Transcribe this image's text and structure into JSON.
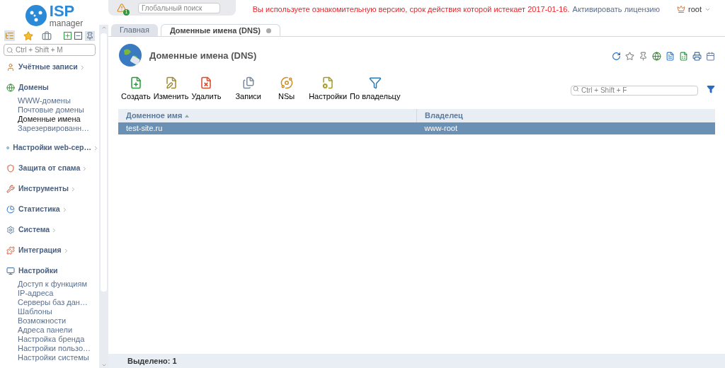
{
  "logo": {
    "big": "ISP",
    "small": "manager"
  },
  "global_search": {
    "placeholder": "Глобальный поиск"
  },
  "notice": {
    "text": "Вы используете ознакомительную версию, срок действия которой истекает 2017-01-16.",
    "link": "Активировать лицензию"
  },
  "user": {
    "name": "root"
  },
  "alert_badge": "1",
  "sidebar": {
    "search": {
      "placeholder": "Ctrl + Shift + M"
    },
    "groups": [
      {
        "title": "Учётные записи"
      },
      {
        "title": "Домены",
        "children": [
          {
            "label": "WWW-домены",
            "selected": false
          },
          {
            "label": "Почтовые домены",
            "selected": false
          },
          {
            "label": "Доменные имена",
            "selected": true
          },
          {
            "label": "Зарезервированн…",
            "selected": false
          }
        ]
      },
      {
        "title": "Настройки web-сер…"
      },
      {
        "title": "Защита от спама"
      },
      {
        "title": "Инструменты"
      },
      {
        "title": "Статистика"
      },
      {
        "title": "Система"
      },
      {
        "title": "Интеграция"
      },
      {
        "title": "Настройки",
        "children": [
          {
            "label": "Доступ к функциям",
            "selected": false
          },
          {
            "label": "IP-адреса",
            "selected": false
          },
          {
            "label": "Серверы баз дан…",
            "selected": false
          },
          {
            "label": "Шаблоны",
            "selected": false
          },
          {
            "label": "Возможности",
            "selected": false
          },
          {
            "label": "Адреса панели",
            "selected": false
          },
          {
            "label": "Настройка бренда",
            "selected": false
          },
          {
            "label": "Настройки пользо…",
            "selected": false
          },
          {
            "label": "Настройки системы",
            "selected": false
          }
        ]
      }
    ]
  },
  "tabs": [
    {
      "label": "Главная",
      "selected": false,
      "closable": false
    },
    {
      "label": "Доменные имена (DNS)",
      "selected": true,
      "closable": true
    }
  ],
  "page_title": "Доменные имена (DNS)",
  "toolbar": [
    "Создать",
    "Изменить",
    "Удалить",
    "Записи",
    "NSы",
    "Настройки",
    "По владельцу"
  ],
  "filter": {
    "placeholder": "Ctrl + Shift + F"
  },
  "table": {
    "columns": [
      {
        "label": "Доменное имя",
        "sorted": true
      },
      {
        "label": "Владелец",
        "sorted": false
      }
    ],
    "rows": [
      {
        "cells": [
          "test-site.ru",
          "www-root"
        ],
        "selected": true
      }
    ]
  },
  "status_bar": {
    "text": "Выделено: 1"
  }
}
